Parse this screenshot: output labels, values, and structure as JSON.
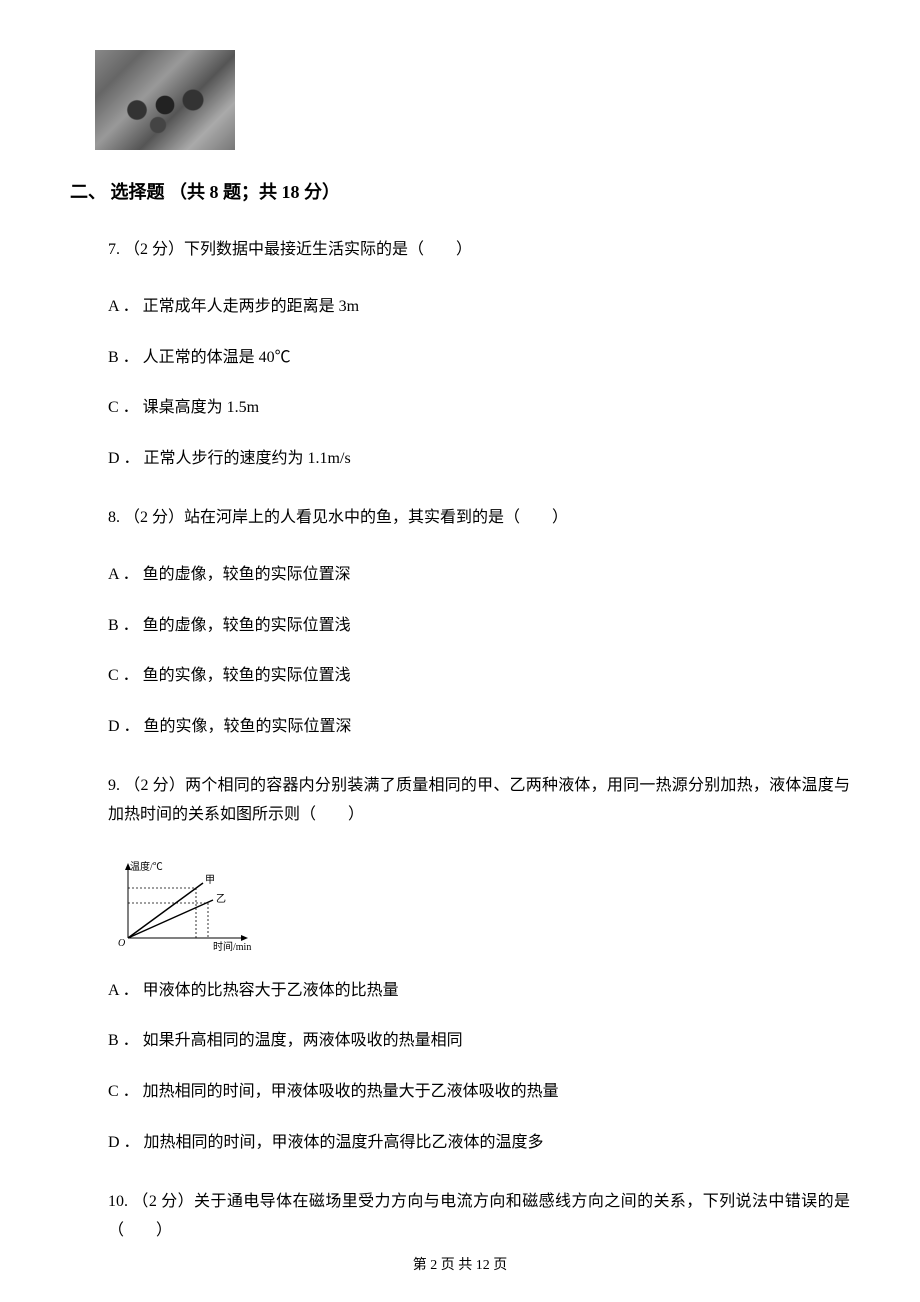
{
  "section": {
    "header": "二、 选择题 （共 8 题；共 18 分）"
  },
  "questions": {
    "q7": {
      "stem": "7. （2 分）下列数据中最接近生活实际的是（　　）",
      "a": "A ． 正常成年人走两步的距离是 3m",
      "b": "B ． 人正常的体温是 40℃",
      "c": "C ． 课桌高度为 1.5m",
      "d": "D ． 正常人步行的速度约为 1.1m/s"
    },
    "q8": {
      "stem": "8. （2 分）站在河岸上的人看见水中的鱼，其实看到的是（　　）",
      "a": "A ． 鱼的虚像，较鱼的实际位置深",
      "b": "B ． 鱼的虚像，较鱼的实际位置浅",
      "c": "C ． 鱼的实像，较鱼的实际位置浅",
      "d": "D ． 鱼的实像，较鱼的实际位置深"
    },
    "q9": {
      "stem": "9. （2 分）两个相同的容器内分别装满了质量相同的甲、乙两种液体，用同一热源分别加热，液体温度与加热时间的关系如图所示则（　　）",
      "a": "A ． 甲液体的比热容大于乙液体的比热量",
      "b": "B ． 如果升高相同的温度，两液体吸收的热量相同",
      "c": "C ． 加热相同的时间，甲液体吸收的热量大于乙液体吸收的热量",
      "d": "D ． 加热相同的时间，甲液体的温度升高得比乙液体的温度多"
    },
    "q10": {
      "stem": "10. （2 分）关于通电导体在磁场里受力方向与电流方向和磁感线方向之间的关系，下列说法中错误的是（　　）"
    }
  },
  "chart": {
    "ylabel": "温度/℃",
    "xlabel": "时间/min",
    "series1": "甲",
    "series2": "乙"
  },
  "footer": {
    "text": "第 2 页 共 12 页"
  }
}
